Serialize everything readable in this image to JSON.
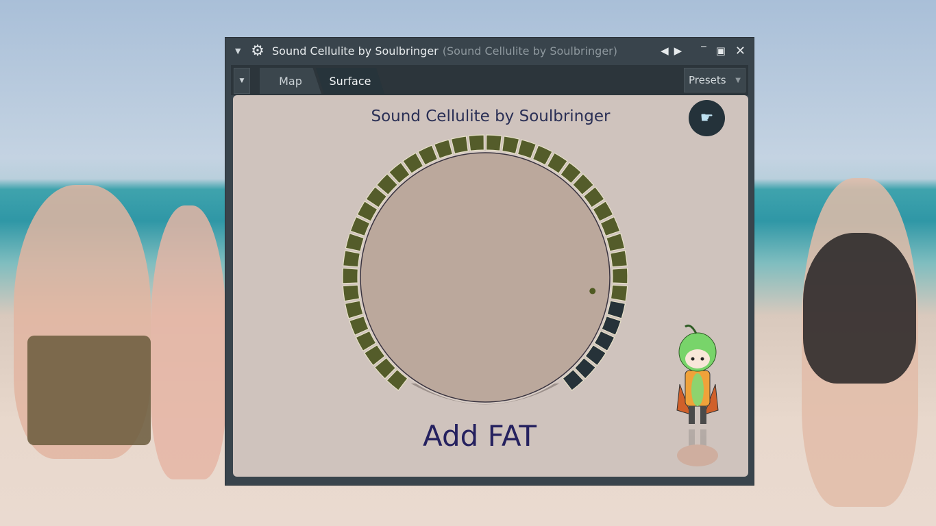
{
  "window": {
    "title": "Sound Cellulite by Soulbringer",
    "subtitle": "(Sound Cellulite by Soulbringer)",
    "icons": [
      "menu-arrow-icon",
      "gear-icon",
      "prev-icon",
      "next-icon",
      "minimize-icon",
      "maximize-icon",
      "close-icon"
    ]
  },
  "toolbar": {
    "tabs": [
      {
        "label": "Map"
      },
      {
        "label": "Surface",
        "active": true
      }
    ],
    "presets_label": "Presets"
  },
  "plugin": {
    "title": "Sound Cellulite by Soulbringer",
    "knob": {
      "label": "Add FAT",
      "value": 0.84,
      "segments": 40
    },
    "colors": {
      "active": "#545c2a",
      "inactive": "#263239",
      "face": "#bba89c",
      "panel": "#cfc3bd"
    }
  }
}
